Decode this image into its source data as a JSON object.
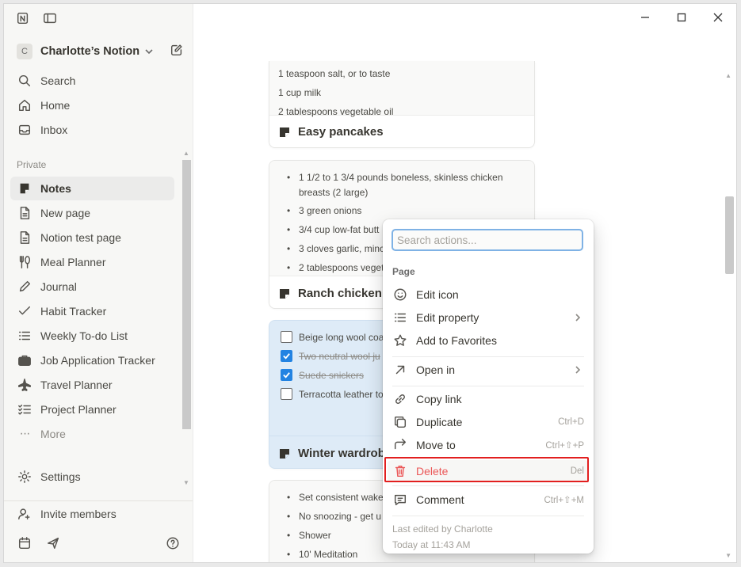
{
  "window": {
    "controls": [
      "minimize",
      "maximize",
      "close"
    ]
  },
  "sidebar": {
    "workspace": {
      "initial": "C",
      "name": "Charlotte’s Notion"
    },
    "top_items": [
      {
        "label": "Search",
        "icon": "search-icon"
      },
      {
        "label": "Home",
        "icon": "home-icon"
      },
      {
        "label": "Inbox",
        "icon": "inbox-icon"
      }
    ],
    "section_label": "Private",
    "private_items": [
      {
        "label": "Notes",
        "icon": "note-icon",
        "active": true
      },
      {
        "label": "New page",
        "icon": "page-icon"
      },
      {
        "label": "Notion test page",
        "icon": "page-icon"
      },
      {
        "label": "Meal Planner",
        "icon": "utensils-icon"
      },
      {
        "label": "Journal",
        "icon": "pencil-icon"
      },
      {
        "label": "Habit Tracker",
        "icon": "check-icon"
      },
      {
        "label": "Weekly To-do List",
        "icon": "list-icon"
      },
      {
        "label": "Job Application Tracker",
        "icon": "briefcase-icon"
      },
      {
        "label": "Travel Planner",
        "icon": "airplane-icon"
      },
      {
        "label": "Project Planner",
        "icon": "checklist-icon"
      },
      {
        "label": "More",
        "icon": "more-icon"
      }
    ],
    "settings_label": "Settings",
    "invite_label": "Invite members"
  },
  "cards": [
    {
      "title": "Easy pancakes",
      "lines": [
        "1 teaspoon salt, or to taste",
        "1 cup milk",
        "2 tablespoons vegetable oil"
      ]
    },
    {
      "title": "Ranch chicken b",
      "bullets": [
        "1 1/2 to 1 3/4 pounds boneless, skinless chicken",
        "breasts (2 large)",
        "3 green onions",
        "3/4 cup low-fat butt",
        "3 cloves garlic, minc",
        "2 tablespoons veget"
      ]
    },
    {
      "title": "Winter wardrob",
      "todos": [
        {
          "text": "Beige long wool coa",
          "done": false
        },
        {
          "text": "Two neutral wool ju",
          "done": true
        },
        {
          "text": "Suede snickers",
          "done": true
        },
        {
          "text": "Terracotta leather to",
          "done": false
        }
      ]
    },
    {
      "bullets": [
        "Set consistent wake",
        "No snoozing - get u",
        "Shower",
        "10' Meditation"
      ]
    }
  ],
  "menu": {
    "search_placeholder": "Search actions...",
    "group_label": "Page",
    "items": [
      {
        "label": "Edit icon",
        "icon": "smiley-icon"
      },
      {
        "label": "Edit property",
        "icon": "list-icon",
        "submenu": true
      },
      {
        "label": "Add to Favorites",
        "icon": "star-icon"
      },
      {
        "label": "Open in",
        "icon": "arrow-up-right-icon",
        "submenu": true
      },
      {
        "label": "Copy link",
        "icon": "link-icon"
      },
      {
        "label": "Duplicate",
        "icon": "duplicate-icon",
        "shortcut": "Ctrl+D"
      },
      {
        "label": "Move to",
        "icon": "move-arrow-icon",
        "shortcut": "Ctrl+⇧+P"
      },
      {
        "label": "Delete",
        "icon": "trash-icon",
        "shortcut": "Del"
      },
      {
        "label": "Comment",
        "icon": "comment-icon",
        "shortcut": "Ctrl+⇧+M"
      }
    ],
    "last_edited": "Last edited by Charlotte",
    "last_edited_time": "Today at 11:43 AM"
  },
  "colors": {
    "accent": "#2383e2",
    "danger": "#eb5757",
    "highlight": "#e21f1f",
    "selected_card": "#deebf7"
  }
}
